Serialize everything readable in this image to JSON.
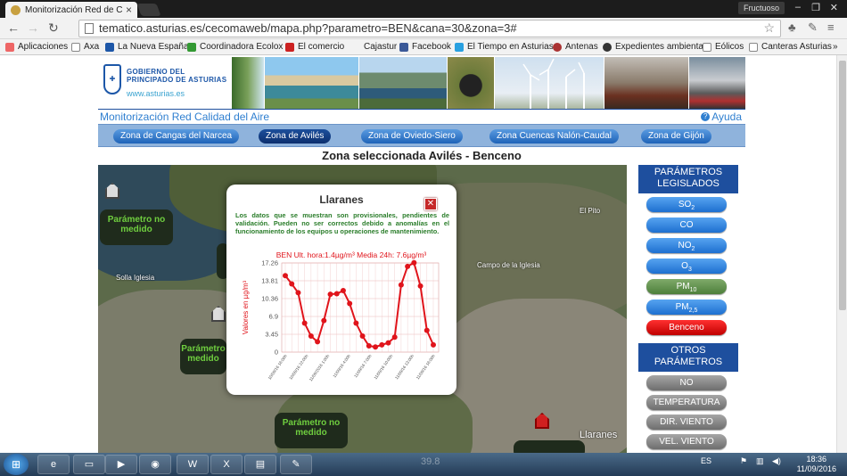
{
  "browser": {
    "tab_title": "Monitorización Red de Ca",
    "user": "Fructuoso",
    "url": "tematico.asturias.es/cecomaweb/mapa.php?parametro=BEN&cana=30&zona=3#",
    "bookmarks": [
      "Aplicaciones",
      "Axa",
      "La Nueva España",
      "Coordinadora Ecolox",
      "El comercio",
      "Cajastur",
      "Facebook",
      "El Tiempo en Asturias",
      "Antenas",
      "Expedientes ambienta",
      "Eólicos",
      "Canteras Asturias"
    ]
  },
  "header": {
    "logo_line1": "GOBIERNO DEL",
    "logo_line2": "PRINCIPADO DE ASTURIAS",
    "logo_url": "www.asturias.es",
    "subtitle": "Monitorización Red Calidad del Aire",
    "help": "Ayuda"
  },
  "zones": [
    "Zona de Cangas del Narcea",
    "Zona de Avilés",
    "Zona de Oviedo-Siero",
    "Zona Cuencas Nalón-Caudal",
    "Zona de Gijón"
  ],
  "zone_title": "Zona seleccionada Avilés - Benceno",
  "map": {
    "labels": [
      "El Pito",
      "Solla Iglesia",
      "Campo de la Iglesia",
      "Llaranes"
    ],
    "param_box": "Parámetro no medido",
    "param_box_partial": "Parámetro medido",
    "faded_value": "39.8"
  },
  "popup": {
    "title": "Llaranes",
    "close": "✕",
    "notice": "Los datos que se muestran son provisionales, pendientes de validación. Pueden no ser correctos debido a anomalías en el funcionamiento de los equipos u operaciones de mantenimiento."
  },
  "chart_data": {
    "type": "line",
    "title": "BEN Ult. hora:1.4µg/m³ Media 24h: 7.6µg/m³",
    "ylabel": "Valores en µg/m³",
    "yticks": [
      0,
      3.45,
      6.9,
      10.36,
      13.81,
      17.26
    ],
    "ylim": [
      0,
      17.26
    ],
    "xticks": [
      "10/09/16 16:00h",
      "10/09/16 22:00h",
      "11/09/2016 1:00h",
      "11/09/16 4:00h",
      "11/09/16 7:00h",
      "11/09/16 10:00h",
      "11/09/16 13:00h",
      "11/09/16 16:00h"
    ],
    "color": "#e0141b",
    "values": [
      14.8,
      13.2,
      11.5,
      5.6,
      3.1,
      2.0,
      6.1,
      11.2,
      11.3,
      11.9,
      9.4,
      5.6,
      3.1,
      1.2,
      1.0,
      1.4,
      1.8,
      2.9,
      13.0,
      16.6,
      17.3,
      12.8,
      4.2,
      1.4
    ]
  },
  "sidebar": {
    "legislated_title": "PARÁMETROS LEGISLADOS",
    "legislated": [
      {
        "label": "SO",
        "sub": "2",
        "style": "blue"
      },
      {
        "label": "CO",
        "sub": "",
        "style": "blue"
      },
      {
        "label": "NO",
        "sub": "2",
        "style": "blue"
      },
      {
        "label": "O",
        "sub": "3",
        "style": "blue"
      },
      {
        "label": "PM",
        "sub": "10",
        "style": "green"
      },
      {
        "label": "PM",
        "sub": "2,5",
        "style": "blue"
      },
      {
        "label": "Benceno",
        "sub": "",
        "style": "red"
      }
    ],
    "other_title": "OTROS PARÁMETROS",
    "other": [
      "NO",
      "TEMPERATURA",
      "DIR. VIENTO",
      "VEL. VIENTO"
    ]
  },
  "taskbar": {
    "lang": "ES",
    "time": "18:36",
    "date": "11/09/2016"
  }
}
